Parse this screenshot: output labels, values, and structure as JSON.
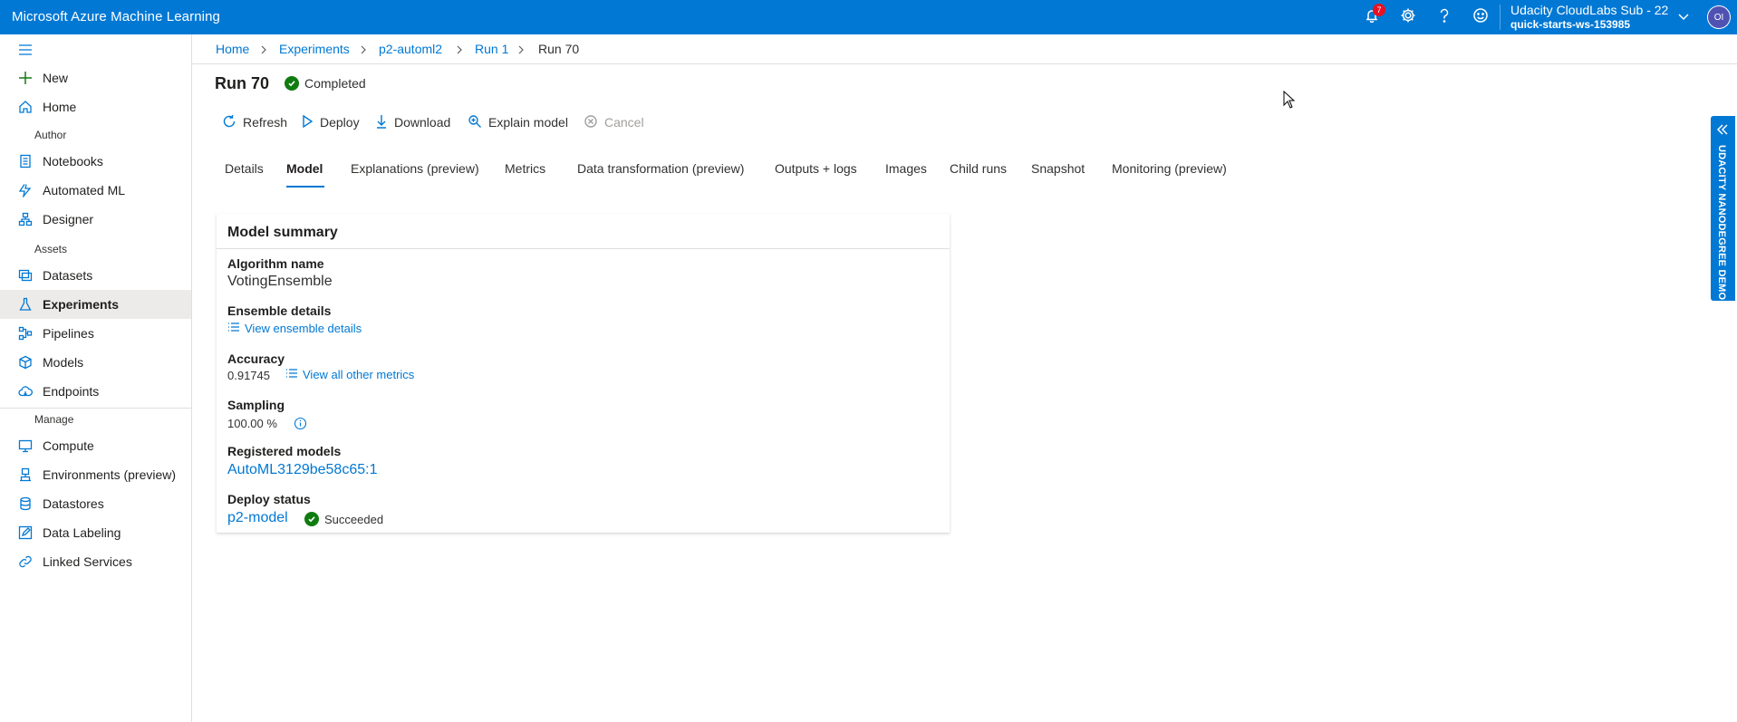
{
  "topbar": {
    "title": "Microsoft Azure Machine Learning",
    "notifications_count": "7",
    "account_subscription": "Udacity CloudLabs Sub - 22",
    "account_workspace": "quick-starts-ws-153985",
    "avatar_initials": "OI",
    "icons": [
      "bell-icon",
      "gear-icon",
      "help-icon",
      "smiley-icon",
      "chevron-down-icon"
    ]
  },
  "sidebar": {
    "top_items": [
      {
        "label": "New",
        "icon": "plus-icon"
      },
      {
        "label": "Home",
        "icon": "home-icon"
      }
    ],
    "sections": {
      "author": "Author",
      "assets": "Assets",
      "manage": "Manage"
    },
    "author_items": [
      {
        "label": "Notebooks",
        "icon": "notebook-icon"
      },
      {
        "label": "Automated ML",
        "icon": "automl-icon"
      },
      {
        "label": "Designer",
        "icon": "designer-icon"
      }
    ],
    "assets_items": [
      {
        "label": "Datasets",
        "icon": "dataset-icon"
      },
      {
        "label": "Experiments",
        "icon": "flask-icon",
        "selected": true
      },
      {
        "label": "Pipelines",
        "icon": "pipeline-icon"
      },
      {
        "label": "Models",
        "icon": "cube-icon"
      },
      {
        "label": "Endpoints",
        "icon": "cloud-icon"
      }
    ],
    "manage_items": [
      {
        "label": "Compute",
        "icon": "monitor-icon"
      },
      {
        "label": "Environments (preview)",
        "icon": "environment-icon"
      },
      {
        "label": "Datastores",
        "icon": "database-icon"
      },
      {
        "label": "Data Labeling",
        "icon": "edit-icon"
      },
      {
        "label": "Linked Services",
        "icon": "link-icon"
      }
    ]
  },
  "breadcrumb": [
    "Home",
    "Experiments",
    "p2-automl2",
    "Run 1",
    "Run 70"
  ],
  "header": {
    "run_title": "Run 70",
    "status": "Completed"
  },
  "toolbar": {
    "refresh": "Refresh",
    "deploy": "Deploy",
    "download": "Download",
    "explain": "Explain model",
    "cancel": "Cancel"
  },
  "tabs": [
    {
      "label": "Details"
    },
    {
      "label": "Model",
      "active": true
    },
    {
      "label": "Explanations (preview)"
    },
    {
      "label": "Metrics"
    },
    {
      "label": "Data transformation (preview)"
    },
    {
      "label": "Outputs + logs"
    },
    {
      "label": "Images"
    },
    {
      "label": "Child runs"
    },
    {
      "label": "Snapshot"
    },
    {
      "label": "Monitoring (preview)"
    }
  ],
  "model_summary": {
    "title": "Model summary",
    "algorithm_label": "Algorithm name",
    "algorithm_value": "VotingEnsemble",
    "ensemble_label": "Ensemble details",
    "ensemble_link": "View ensemble details",
    "accuracy_label": "Accuracy",
    "accuracy_value": "0.91745",
    "metrics_link": "View all other metrics",
    "sampling_label": "Sampling",
    "sampling_value": "100.00 %",
    "registered_label": "Registered models",
    "registered_value": "AutoML3129be58c65:1",
    "deploy_label": "Deploy status",
    "deploy_model": "p2-model",
    "deploy_status": "Succeeded"
  },
  "side_banner": {
    "text": "UDACITY NANODEGREE DEMO"
  },
  "colors": {
    "brand": "#0078d4",
    "success": "#107c10",
    "badge": "#e81123"
  }
}
